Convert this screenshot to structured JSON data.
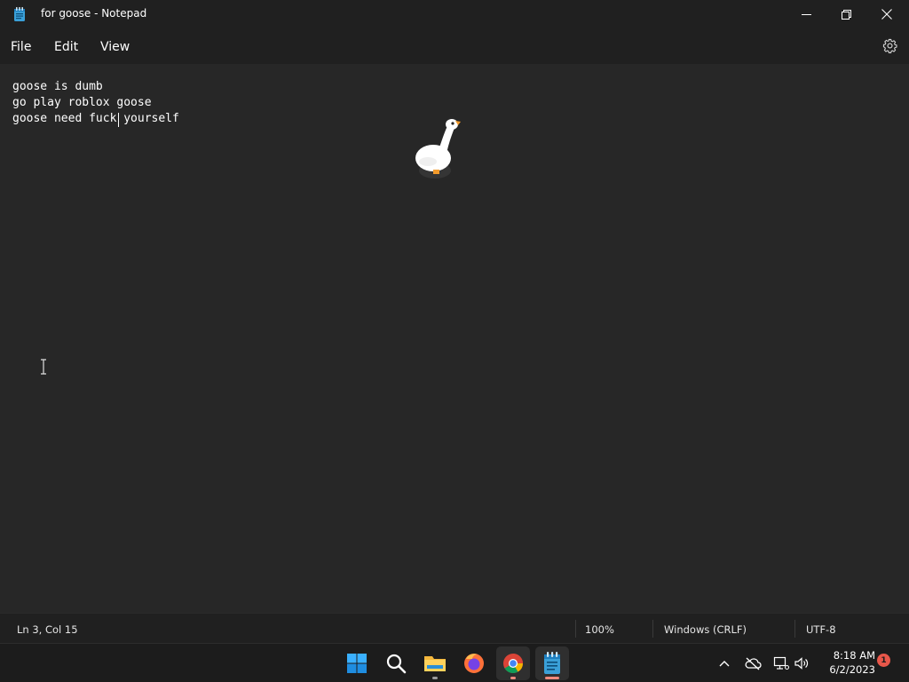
{
  "window": {
    "title": "for goose - Notepad"
  },
  "menu": {
    "items": [
      "File",
      "Edit",
      "View"
    ]
  },
  "editor": {
    "lines": [
      "goose is dumb",
      "go play roblox goose",
      "goose need fuck yourself"
    ]
  },
  "status": {
    "position": "Ln 3, Col 15",
    "zoom": "100%",
    "line_ending": "Windows (CRLF)",
    "encoding": "UTF-8"
  },
  "taskbar": {
    "apps": [
      "start",
      "search",
      "file-explorer",
      "firefox",
      "chrome",
      "notepad"
    ]
  },
  "tray": {
    "time": "8:18 AM",
    "date": "6/2/2023",
    "notification_count": "1"
  },
  "colors": {
    "background": "#202020",
    "editor": "#272727",
    "accent": "#0078d4",
    "notification": "#e8574a"
  },
  "icons": {
    "app": "notepad-icon",
    "minimize": "minimize-icon",
    "maximize": "restore-icon",
    "close": "close-icon",
    "settings": "gear-icon",
    "tray": [
      "chevron-up-icon",
      "onedrive-offline-icon",
      "network-icon",
      "volume-icon"
    ]
  }
}
